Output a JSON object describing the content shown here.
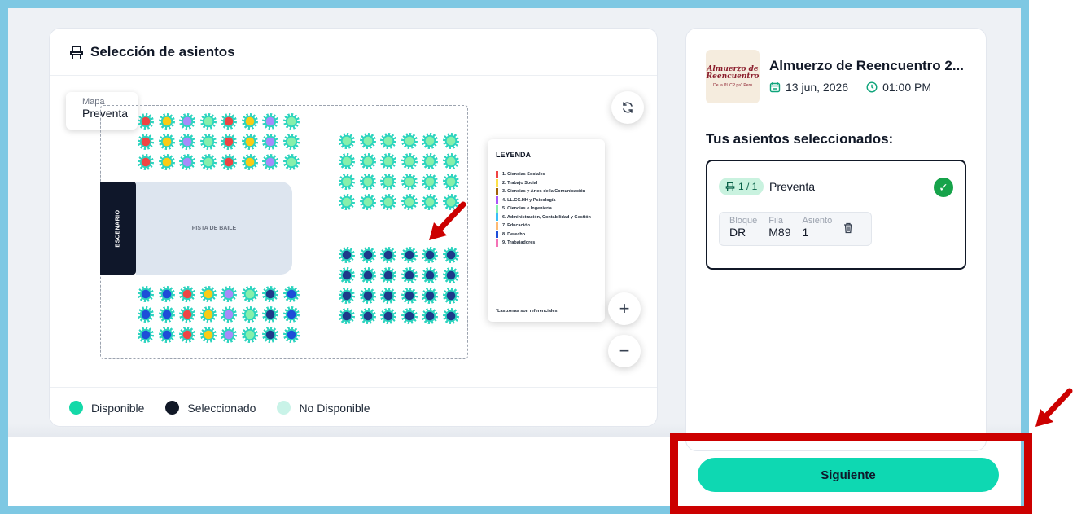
{
  "seat_selection": {
    "title": "Selección de asientos",
    "map_chip": {
      "label_small": "Mapa",
      "label_big": "Preventa"
    },
    "stage_label": "ESCENARIO",
    "dance_floor_label": "PISTA DE BAILE",
    "legend": {
      "title": "LEYENDA",
      "items": [
        {
          "label": "1. Ciencias Sociales",
          "color": "#ef4444"
        },
        {
          "label": "2. Trabajo Social",
          "color": "#fde047"
        },
        {
          "label": "3. Ciencias y Artes de la Comunicación",
          "color": "#a16207"
        },
        {
          "label": "4. LL.CC.HH y Psicología",
          "color": "#a855f7"
        },
        {
          "label": "5. Ciencias e Ingeniería",
          "color": "#86efac"
        },
        {
          "label": "6. Administración, Contabilidad y Gestión",
          "color": "#38bdf8"
        },
        {
          "label": "7. Educación",
          "color": "#fdba74"
        },
        {
          "label": "8. Derecho",
          "color": "#1d4ed8"
        },
        {
          "label": "9. Trabajadores",
          "color": "#f472b6"
        }
      ],
      "note": "*Las zonas son referenciales"
    },
    "status_legend": [
      {
        "label": "Disponible",
        "color": "#14d9a8"
      },
      {
        "label": "Seleccionado",
        "color": "#111827"
      },
      {
        "label": "No Disponible",
        "color": "#c9f3e8"
      }
    ],
    "zoom_in": "+",
    "zoom_out": "−",
    "refresh_icon": "refresh-icon"
  },
  "event": {
    "thumb_line1": "Almuerzo de",
    "thumb_line2": "Reencuentro",
    "thumb_line3": "De la PUCP pa'l Perú",
    "title": "Almuerzo de Reencuentro 2...",
    "date": "13 jun, 2026",
    "time": "01:00 PM"
  },
  "selected": {
    "heading": "Tus asientos seleccionados:",
    "qty": "1 / 1",
    "zone": "Preventa",
    "block_label": "Bloque",
    "block_value": "DR",
    "row_label": "Fila",
    "row_value": "M89",
    "seat_label": "Asiento",
    "seat_value": "1"
  },
  "actions": {
    "next_label": "Siguiente"
  }
}
